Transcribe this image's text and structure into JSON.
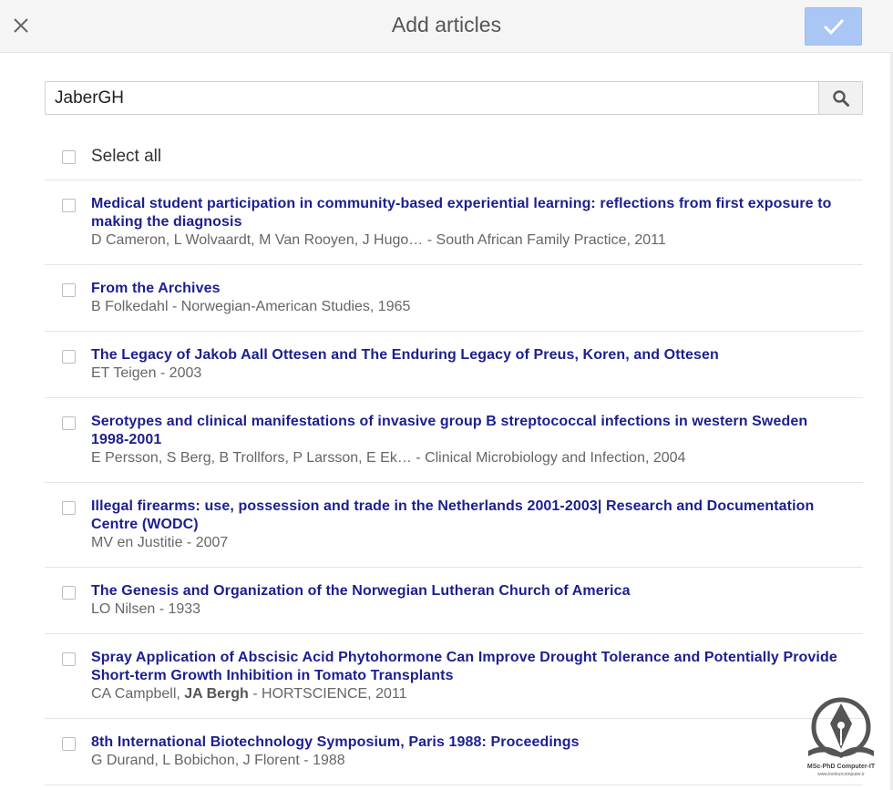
{
  "header": {
    "title": "Add articles"
  },
  "search": {
    "value": "JaberGH"
  },
  "select_all": {
    "label": "Select all"
  },
  "articles": [
    {
      "title": "Medical student participation in community-based experiential learning: reflections from first exposure to making the diagnosis",
      "meta": "D Cameron, L Wolvaardt, M Van Rooyen, J Hugo… - South African Family Practice, 2011"
    },
    {
      "title": "From the Archives",
      "meta": "B Folkedahl - Norwegian-American Studies, 1965"
    },
    {
      "title": "The Legacy of Jakob Aall Ottesen and The Enduring Legacy of Preus, Koren, and Ottesen",
      "meta": "ET Teigen - 2003"
    },
    {
      "title": "Serotypes and clinical manifestations of invasive group B streptococcal infections in western Sweden 1998-2001",
      "meta": "E Persson, S Berg, B Trollfors, P Larsson, E Ek… - Clinical Microbiology and Infection, 2004"
    },
    {
      "title": "Illegal firearms: use, possession and trade in the Netherlands 2001-2003| Research and Documentation Centre (WODC)",
      "meta": "MV en Justitie - 2007"
    },
    {
      "title": "The Genesis and Organization of the Norwegian Lutheran Church of America",
      "meta": "LO Nilsen - 1933"
    },
    {
      "title": "Spray Application of Abscisic Acid Phytohormone Can Improve Drought Tolerance and Potentially Provide Short-term Growth Inhibition in Tomato Transplants",
      "meta_before": "CA Campbell, ",
      "meta_bold": "JA Bergh",
      "meta_after": " - HORTSCIENCE, 2011"
    },
    {
      "title": "8th International Biotechnology Symposium, Paris 1988: Proceedings",
      "meta": "G Durand, L Bobichon, J Florent - 1988"
    }
  ],
  "watermark": {
    "line1": "MSc-PhD Computer-IT",
    "line2": "www.konkurcomputer.ir"
  }
}
